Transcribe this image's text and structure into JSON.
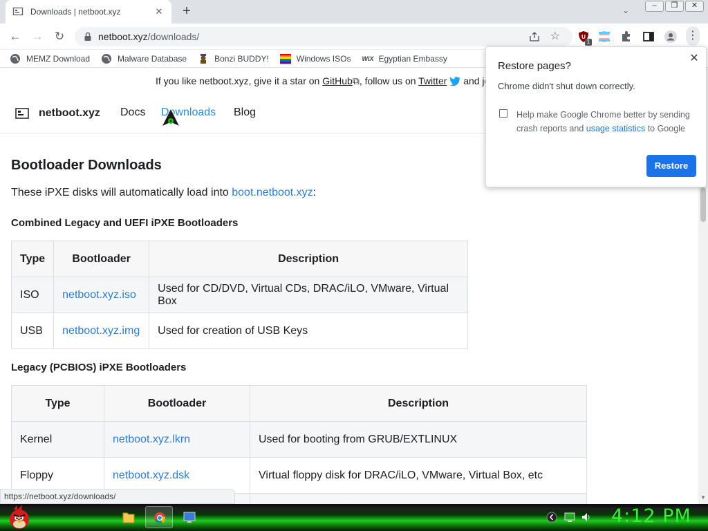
{
  "tab": {
    "title": "Downloads | netboot.xyz"
  },
  "toolbar": {
    "url_host": "netboot.xyz",
    "url_path": "/downloads/",
    "extension_badge": "1"
  },
  "bookmarks": [
    "MEMZ Download",
    "Malware Database",
    "Bonzi BUDDY!",
    "Windows ISOs",
    "Egyptian Embassy"
  ],
  "banner": {
    "text1": "If you like netboot.xyz, give it a star on ",
    "github": "GitHub",
    "text2": ", follow us on ",
    "twitter": "Twitter",
    "text3": " and join"
  },
  "site": {
    "name": "netboot.xyz",
    "nav": [
      "Docs",
      "Downloads",
      "Blog"
    ],
    "active_nav": "Downloads"
  },
  "content": {
    "heading": "Bootloader Downloads",
    "intro_text": "These iPXE disks will automatically load into ",
    "intro_link": "boot.netboot.xyz",
    "intro_end": ":",
    "section1": "Combined Legacy and UEFI iPXE Bootloaders",
    "section2": "Legacy (PCBIOS) iPXE Bootloaders",
    "columns": [
      "Type",
      "Bootloader",
      "Description"
    ],
    "table1": [
      {
        "type": "ISO",
        "bootloader": "netboot.xyz.iso",
        "description": "Used for CD/DVD, Virtual CDs, DRAC/iLO, VMware, Virtual Box"
      },
      {
        "type": "USB",
        "bootloader": "netboot.xyz.img",
        "description": "Used for creation of USB Keys"
      }
    ],
    "table2": [
      {
        "type": "Kernel",
        "bootloader": "netboot.xyz.lkrn",
        "description": "Used for booting from GRUB/EXTLINUX"
      },
      {
        "type": "Floppy",
        "bootloader": "netboot.xyz.dsk",
        "description": "Virtual floppy disk for DRAC/iLO, VMware, Virtual Box, etc"
      }
    ]
  },
  "status_url": "https://netboot.xyz/downloads/",
  "restore_popup": {
    "title": "Restore pages?",
    "message": "Chrome didn't shut down correctly.",
    "check_label_1": "Help make Google Chrome better by sending crash reports and ",
    "check_link": "usage statistics",
    "check_label_2": " to Google",
    "button": "Restore",
    "checked": false
  },
  "taskbar": {
    "clock": "4:12 PM"
  },
  "colors": {
    "accent": "#1a73e8",
    "link": "#2e7bcf",
    "taskbar_green": "#1ecc1e",
    "clock": "#37ef37"
  }
}
